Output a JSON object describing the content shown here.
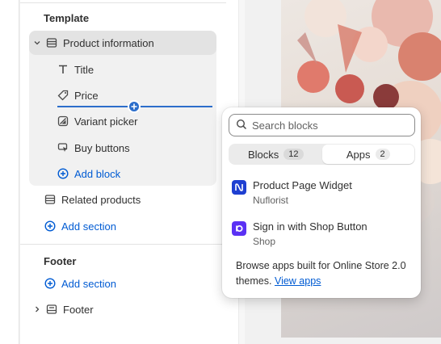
{
  "template_heading": "Template",
  "product_info": {
    "label": "Product information"
  },
  "blocks": [
    {
      "label": "Title"
    },
    {
      "label": "Price"
    },
    {
      "label": "Variant picker"
    },
    {
      "label": "Buy buttons"
    }
  ],
  "add_block_label": "Add block",
  "related_products_label": "Related products",
  "add_section_label": "Add section",
  "footer_heading": "Footer",
  "footer_add_section_label": "Add section",
  "footer_group_label": "Footer",
  "popover": {
    "search_placeholder": "Search blocks",
    "tabs": [
      {
        "label": "Blocks",
        "count": "12",
        "active": false
      },
      {
        "label": "Apps",
        "count": "2",
        "active": true
      }
    ],
    "apps": [
      {
        "name": "Product Page Widget",
        "vendor": "Nuflorist",
        "icon_color": "#1e3fd1"
      },
      {
        "name": "Sign in with Shop Button",
        "vendor": "Shop",
        "icon_color": "#5a31f4"
      }
    ],
    "browse_text": "Browse apps built for Online Store 2.0 themes.",
    "view_apps_link": "View apps"
  },
  "colors": {
    "accent": "#005bd3",
    "insert_indicator": "#2c6ecb"
  }
}
